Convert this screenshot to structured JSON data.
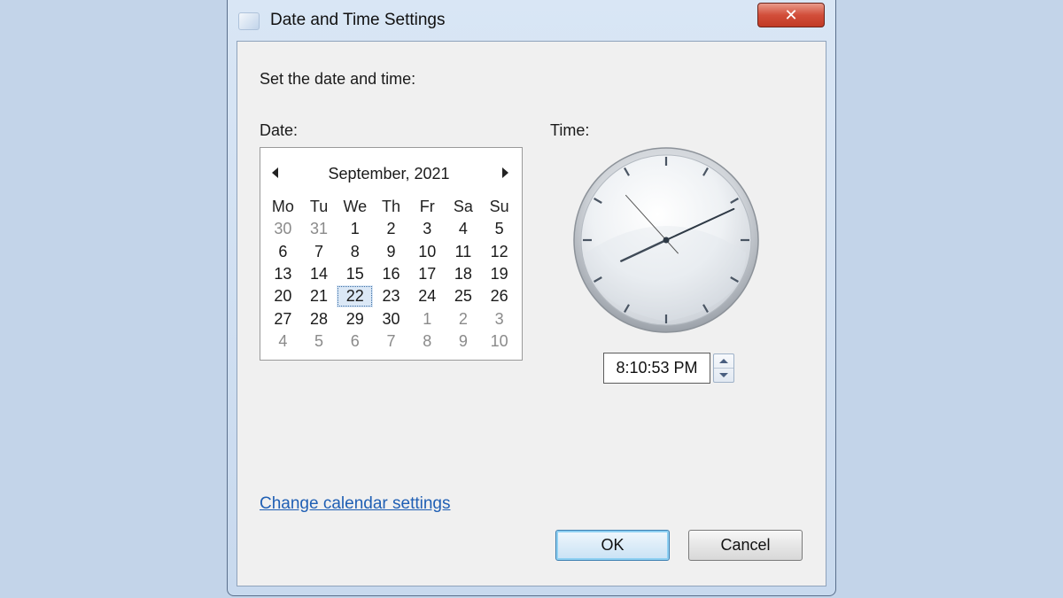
{
  "window": {
    "title": "Date and Time Settings",
    "close_label": "✕"
  },
  "heading": "Set the date and time:",
  "date_label": "Date:",
  "time_label": "Time:",
  "calendar": {
    "month_label": "September, 2021",
    "weekdays": [
      "Mo",
      "Tu",
      "We",
      "Th",
      "Fr",
      "Sa",
      "Su"
    ],
    "days": [
      {
        "d": "30",
        "other": true
      },
      {
        "d": "31",
        "other": true
      },
      {
        "d": "1"
      },
      {
        "d": "2"
      },
      {
        "d": "3"
      },
      {
        "d": "4"
      },
      {
        "d": "5"
      },
      {
        "d": "6"
      },
      {
        "d": "7"
      },
      {
        "d": "8"
      },
      {
        "d": "9"
      },
      {
        "d": "10"
      },
      {
        "d": "11"
      },
      {
        "d": "12"
      },
      {
        "d": "13"
      },
      {
        "d": "14"
      },
      {
        "d": "15"
      },
      {
        "d": "16"
      },
      {
        "d": "17"
      },
      {
        "d": "18"
      },
      {
        "d": "19"
      },
      {
        "d": "20"
      },
      {
        "d": "21"
      },
      {
        "d": "22",
        "selected": true
      },
      {
        "d": "23"
      },
      {
        "d": "24"
      },
      {
        "d": "25"
      },
      {
        "d": "26"
      },
      {
        "d": "27"
      },
      {
        "d": "28"
      },
      {
        "d": "29"
      },
      {
        "d": "30"
      },
      {
        "d": "1",
        "other": true
      },
      {
        "d": "2",
        "other": true
      },
      {
        "d": "3",
        "other": true
      },
      {
        "d": "4",
        "other": true
      },
      {
        "d": "5",
        "other": true
      },
      {
        "d": "6",
        "other": true
      },
      {
        "d": "7",
        "other": true
      },
      {
        "d": "8",
        "other": true
      },
      {
        "d": "9",
        "other": true
      },
      {
        "d": "10",
        "other": true
      }
    ]
  },
  "clock": {
    "hours": 8,
    "minutes": 10,
    "seconds": 53
  },
  "time_value": "8:10:53 PM",
  "change_calendar_link": "Change calendar settings",
  "buttons": {
    "ok": "OK",
    "cancel": "Cancel"
  },
  "colors": {
    "accent_link": "#1f5fb4",
    "close_button": "#c13a25"
  }
}
